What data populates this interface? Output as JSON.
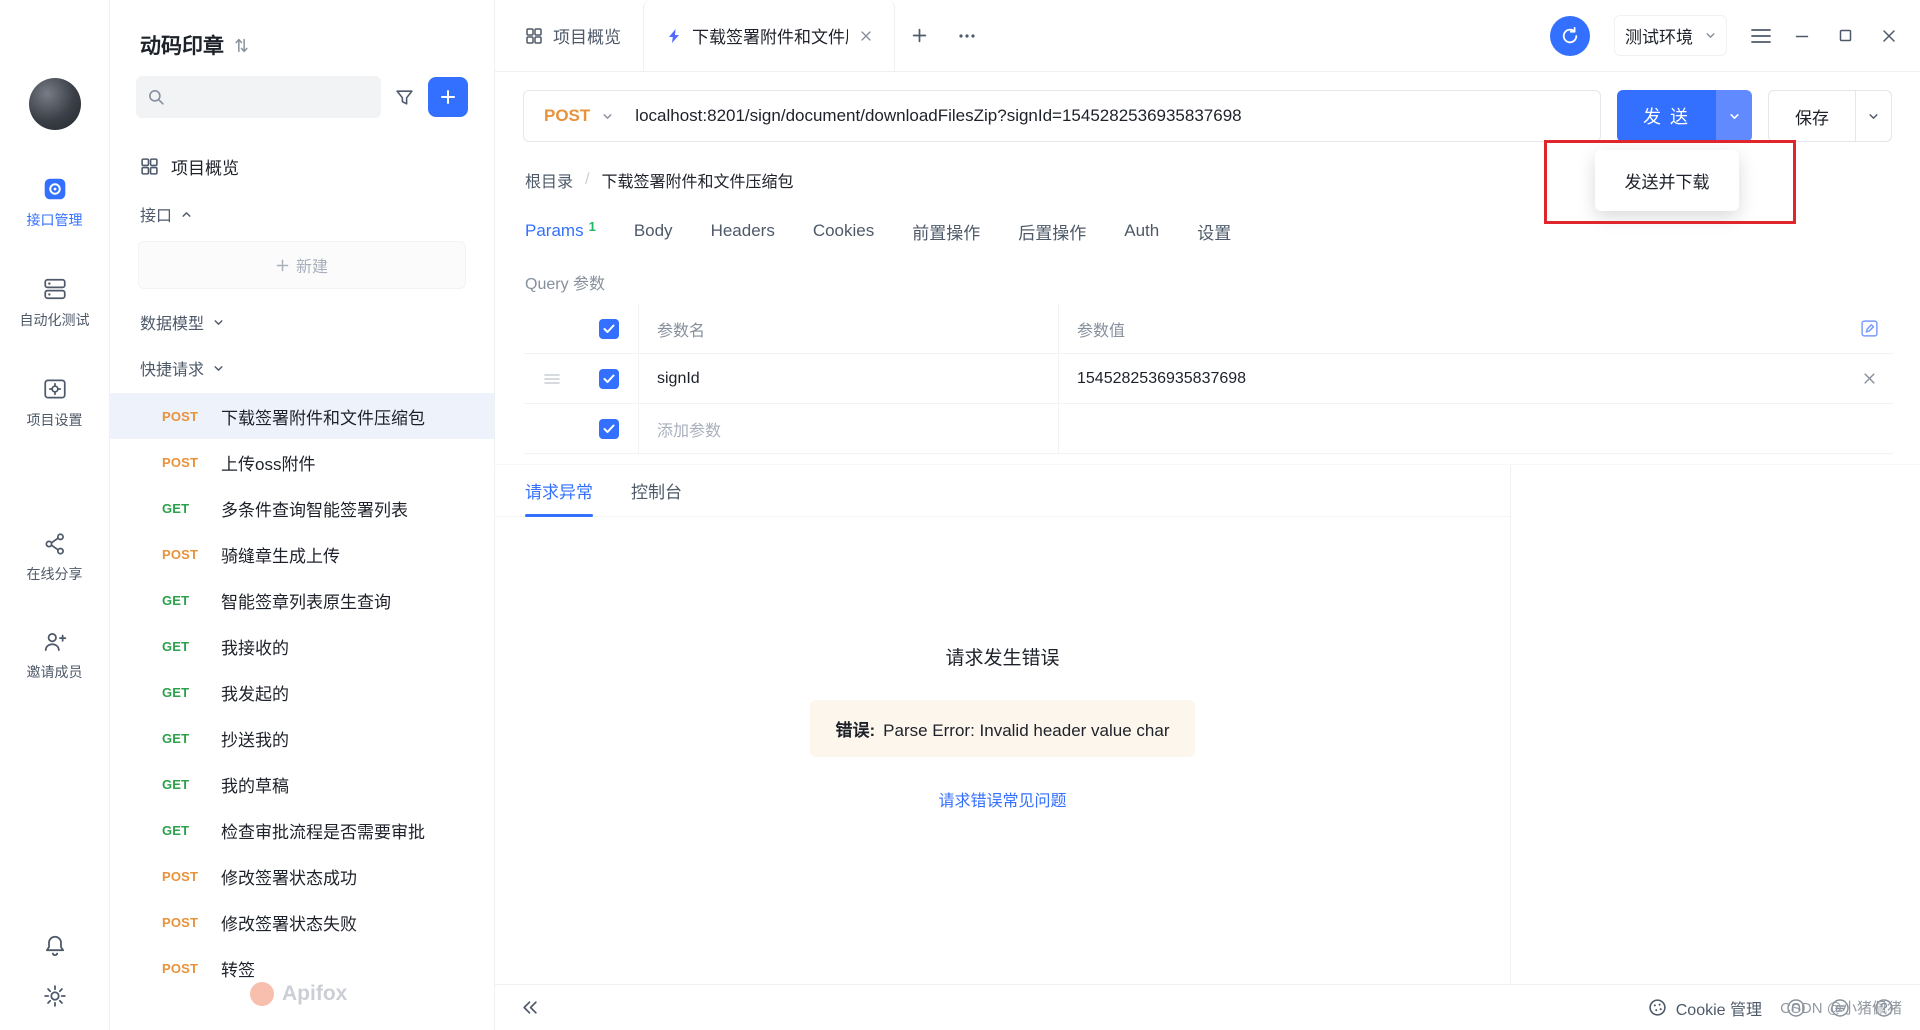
{
  "project": {
    "name": "动码印章"
  },
  "rail": {
    "items": [
      {
        "label": "接口管理"
      },
      {
        "label": "自动化测试"
      },
      {
        "label": "项目设置"
      },
      {
        "label": "在线分享"
      },
      {
        "label": "邀请成员"
      }
    ]
  },
  "sidebar": {
    "overview": "项目概览",
    "api_section": "接口",
    "new_button": "新建",
    "models_section": "数据模型",
    "quick_section": "快捷请求",
    "requests": [
      {
        "method": "POST",
        "name": "下载签署附件和文件压缩包"
      },
      {
        "method": "POST",
        "name": "上传oss附件"
      },
      {
        "method": "GET",
        "name": "多条件查询智能签署列表"
      },
      {
        "method": "POST",
        "name": "骑缝章生成上传"
      },
      {
        "method": "GET",
        "name": "智能签章列表原生查询"
      },
      {
        "method": "GET",
        "name": "我接收的"
      },
      {
        "method": "GET",
        "name": "我发起的"
      },
      {
        "method": "GET",
        "name": "抄送我的"
      },
      {
        "method": "GET",
        "name": "我的草稿"
      },
      {
        "method": "GET",
        "name": "检查审批流程是否需要审批"
      },
      {
        "method": "POST",
        "name": "修改签署状态成功"
      },
      {
        "method": "POST",
        "name": "修改签署状态失败"
      },
      {
        "method": "POST",
        "name": "转签"
      }
    ]
  },
  "tabbar": {
    "overview_tab": "项目概览",
    "active_tab": "下载签署附件和文件压缩包",
    "env": "测试环境"
  },
  "request": {
    "method": "POST",
    "url": "localhost:8201/sign/document/downloadFilesZip?signId=1545282536935837698",
    "send_label": "发 送",
    "save_label": "保存",
    "send_menu_item": "发送并下载"
  },
  "breadcrumb": {
    "root": "根目录",
    "sep": "/",
    "current": "下载签署附件和文件压缩包"
  },
  "request_tabs": [
    {
      "label": "Params",
      "badge": "1"
    },
    {
      "label": "Body"
    },
    {
      "label": "Headers"
    },
    {
      "label": "Cookies"
    },
    {
      "label": "前置操作"
    },
    {
      "label": "后置操作"
    },
    {
      "label": "Auth"
    },
    {
      "label": "设置"
    }
  ],
  "params": {
    "section": "Query 参数",
    "col_name": "参数名",
    "col_value": "参数值",
    "rows": [
      {
        "name": "signId",
        "value": "1545282536935837698"
      }
    ],
    "add_placeholder": "添加参数"
  },
  "response": {
    "tab_error": "请求异常",
    "tab_console": "控制台",
    "title": "请求发生错误",
    "error_label": "错误:",
    "error_message": "Parse Error: Invalid header value char",
    "faq_link": "请求错误常见问题"
  },
  "statusbar": {
    "cookie": "Cookie 管理"
  },
  "watermark": {
    "csdn": "CSDN @小猪佩猪",
    "brand": "Apifox"
  },
  "colors": {
    "primary": "#3370ff",
    "post": "#e8923c",
    "get": "#2ba24a",
    "error_bg": "#fdf6ec",
    "annotation_red": "#e0262d",
    "badge_green": "#1fb85f"
  }
}
